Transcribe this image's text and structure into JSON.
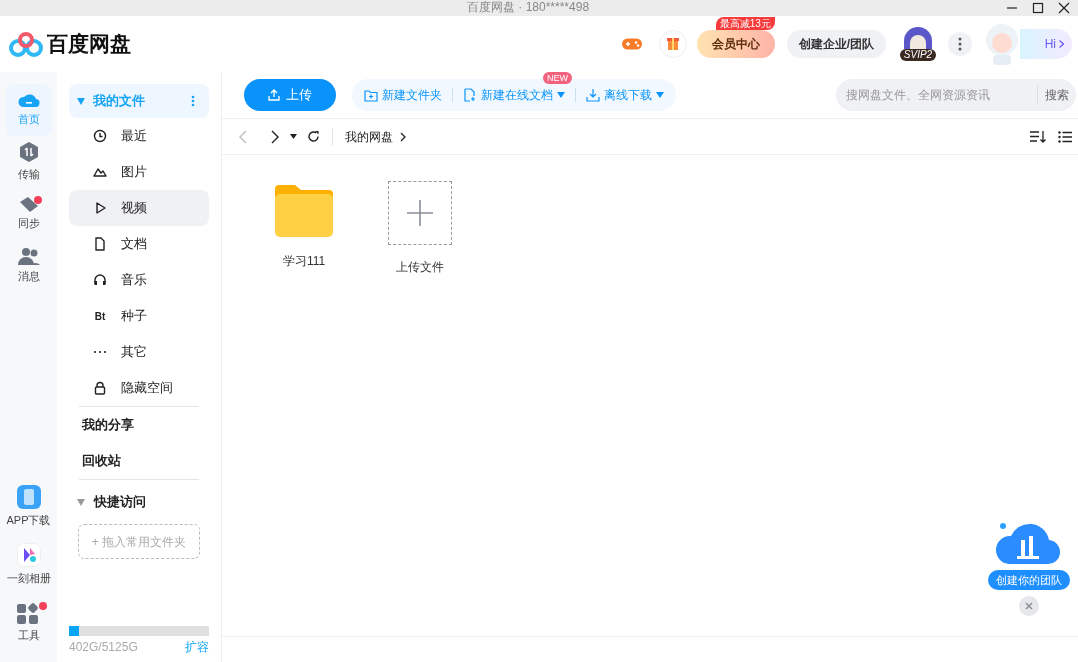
{
  "window": {
    "title": "百度网盘 · 180*****498"
  },
  "header": {
    "logo": "百度网盘",
    "promo_badge": "最高减13元",
    "vip_button": "会员中心",
    "team_button": "创建企业/团队",
    "level_badge": "SVIP2",
    "hi": "Hi"
  },
  "rail": {
    "items": [
      {
        "label": "首页",
        "selected": true,
        "badge": false
      },
      {
        "label": "传输",
        "selected": false,
        "badge": false
      },
      {
        "label": "同步",
        "selected": false,
        "badge": true
      },
      {
        "label": "消息",
        "selected": false,
        "badge": false
      }
    ],
    "bottom": [
      {
        "label": "APP下载",
        "badge": false
      },
      {
        "label": "一刻相册",
        "badge": false
      },
      {
        "label": "工具",
        "badge": true
      }
    ]
  },
  "nav": {
    "my_files": {
      "label": "我的文件",
      "expanded": true
    },
    "categories": [
      {
        "label": "最近",
        "selected": false
      },
      {
        "label": "图片",
        "selected": false
      },
      {
        "label": "视频",
        "selected": true
      },
      {
        "label": "文档",
        "selected": false
      },
      {
        "label": "音乐",
        "selected": false
      },
      {
        "label": "种子",
        "icon_text": "Bt",
        "selected": false
      },
      {
        "label": "其它",
        "selected": false
      },
      {
        "label": "隐藏空间",
        "selected": false
      }
    ],
    "sections": [
      "我的分享",
      "回收站"
    ],
    "quick_access": {
      "label": "快捷访问",
      "expanded": true,
      "drop_hint": "+ 拖入常用文件夹"
    },
    "storage": {
      "level": 0.07,
      "text": "402G/5125G",
      "expand": "扩容"
    }
  },
  "toolbar": {
    "upload": "上传",
    "actions": [
      {
        "label": "新建文件夹",
        "dropdown": false,
        "new": false
      },
      {
        "label": "新建在线文档",
        "dropdown": true,
        "new": true
      },
      {
        "label": "离线下载",
        "dropdown": true,
        "new": false
      }
    ],
    "new_badge": "NEW",
    "search": {
      "placeholder": "搜网盘文件、全网资源资讯",
      "button": "搜索"
    }
  },
  "breadcrumb": [
    "我的网盘"
  ],
  "files": [
    {
      "kind": "folder",
      "name": "学习111"
    },
    {
      "kind": "upload",
      "name": "上传文件"
    }
  ],
  "team_promo": {
    "label": "创建你的团队"
  }
}
